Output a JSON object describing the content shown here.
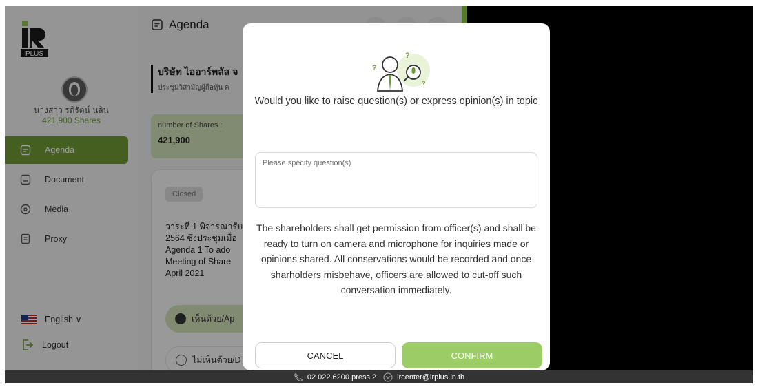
{
  "sidebar": {
    "logo_text": "PLUS",
    "user_name": "นางสาว รติรัตน์ นลิน",
    "user_shares": "421,900 Shares",
    "nav": [
      {
        "label": "Agenda",
        "icon": "agenda-icon",
        "active": true
      },
      {
        "label": "Document",
        "icon": "document-icon",
        "active": false
      },
      {
        "label": "Media",
        "icon": "media-icon",
        "active": false
      },
      {
        "label": "Proxy",
        "icon": "proxy-icon",
        "active": false
      }
    ],
    "language": "English ∨",
    "logout": "Logout"
  },
  "main": {
    "title": "Agenda",
    "company_name": "บริษัท ไออาร์พลัส จ",
    "company_sub": "ประชุมวิสามัญผู้ถือหุ้น ค",
    "shares_label": "number of Shares :",
    "shares_value": "421,900",
    "status_badge": "Closed",
    "agenda_lines": [
      "วาระที่ 1 พิจารณารับ",
      "2564 ซึ่งประชุมเมื่อ",
      "Agenda 1 To ado",
      "Meeting of Share",
      "April 2021"
    ],
    "vote_approve": "เห็นด้วย/Ap",
    "vote_disapprove": "ไม่เห็นด้วย/D"
  },
  "modal": {
    "question": "Would you like to raise question(s) or express opinion(s) in topic",
    "placeholder": "Please specify question(s)",
    "notice": "The shareholders shall get permission from officer(s) and shall be ready to turn on camera and microphone for inquiries made or opinions shared. All conservations would be recorded and once sharholders misbehave, officers are allowed to cut-off such conversation immediately.",
    "cancel": "CANCEL",
    "confirm": "CONFIRM"
  },
  "footer": {
    "phone": "02 022 6200 press 2",
    "email": "ircenter@irplus.in.th"
  },
  "colors": {
    "accent_green": "#6f9a35",
    "light_green": "#cfe0b7",
    "confirm_green": "#9ccc65",
    "footer_bg": "#333333"
  }
}
